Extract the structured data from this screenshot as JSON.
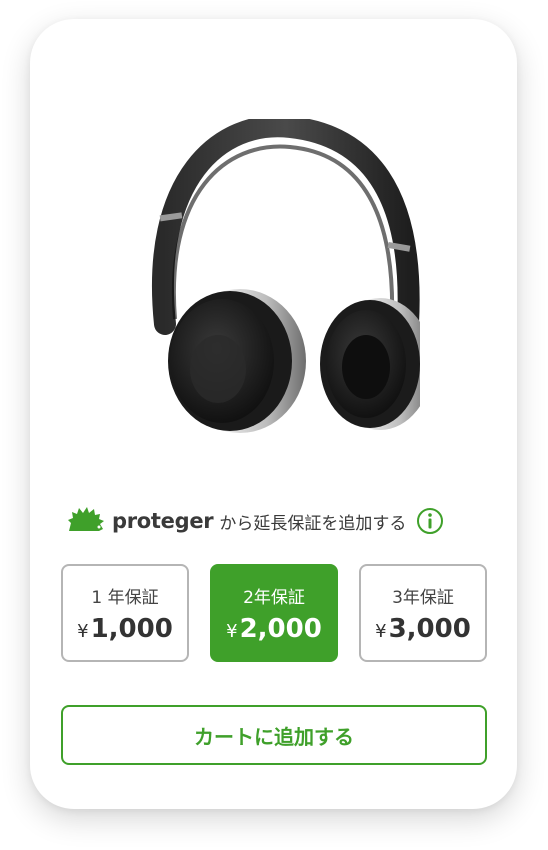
{
  "product": {
    "image_icon": "headphones-image"
  },
  "warranty": {
    "brand_name": "proteger",
    "prompt_text": "から延長保証を追加する",
    "info_icon": "info-icon",
    "brand_color": "#3fa02a",
    "options": [
      {
        "label": "1 年保証",
        "currency": "¥",
        "price": "1,000",
        "selected": false
      },
      {
        "label": "2年保証",
        "currency": "¥",
        "price": "2,000",
        "selected": true
      },
      {
        "label": "3年保証",
        "currency": "¥",
        "price": "3,000",
        "selected": false
      }
    ]
  },
  "cart": {
    "add_button_label": "カートに追加する"
  }
}
